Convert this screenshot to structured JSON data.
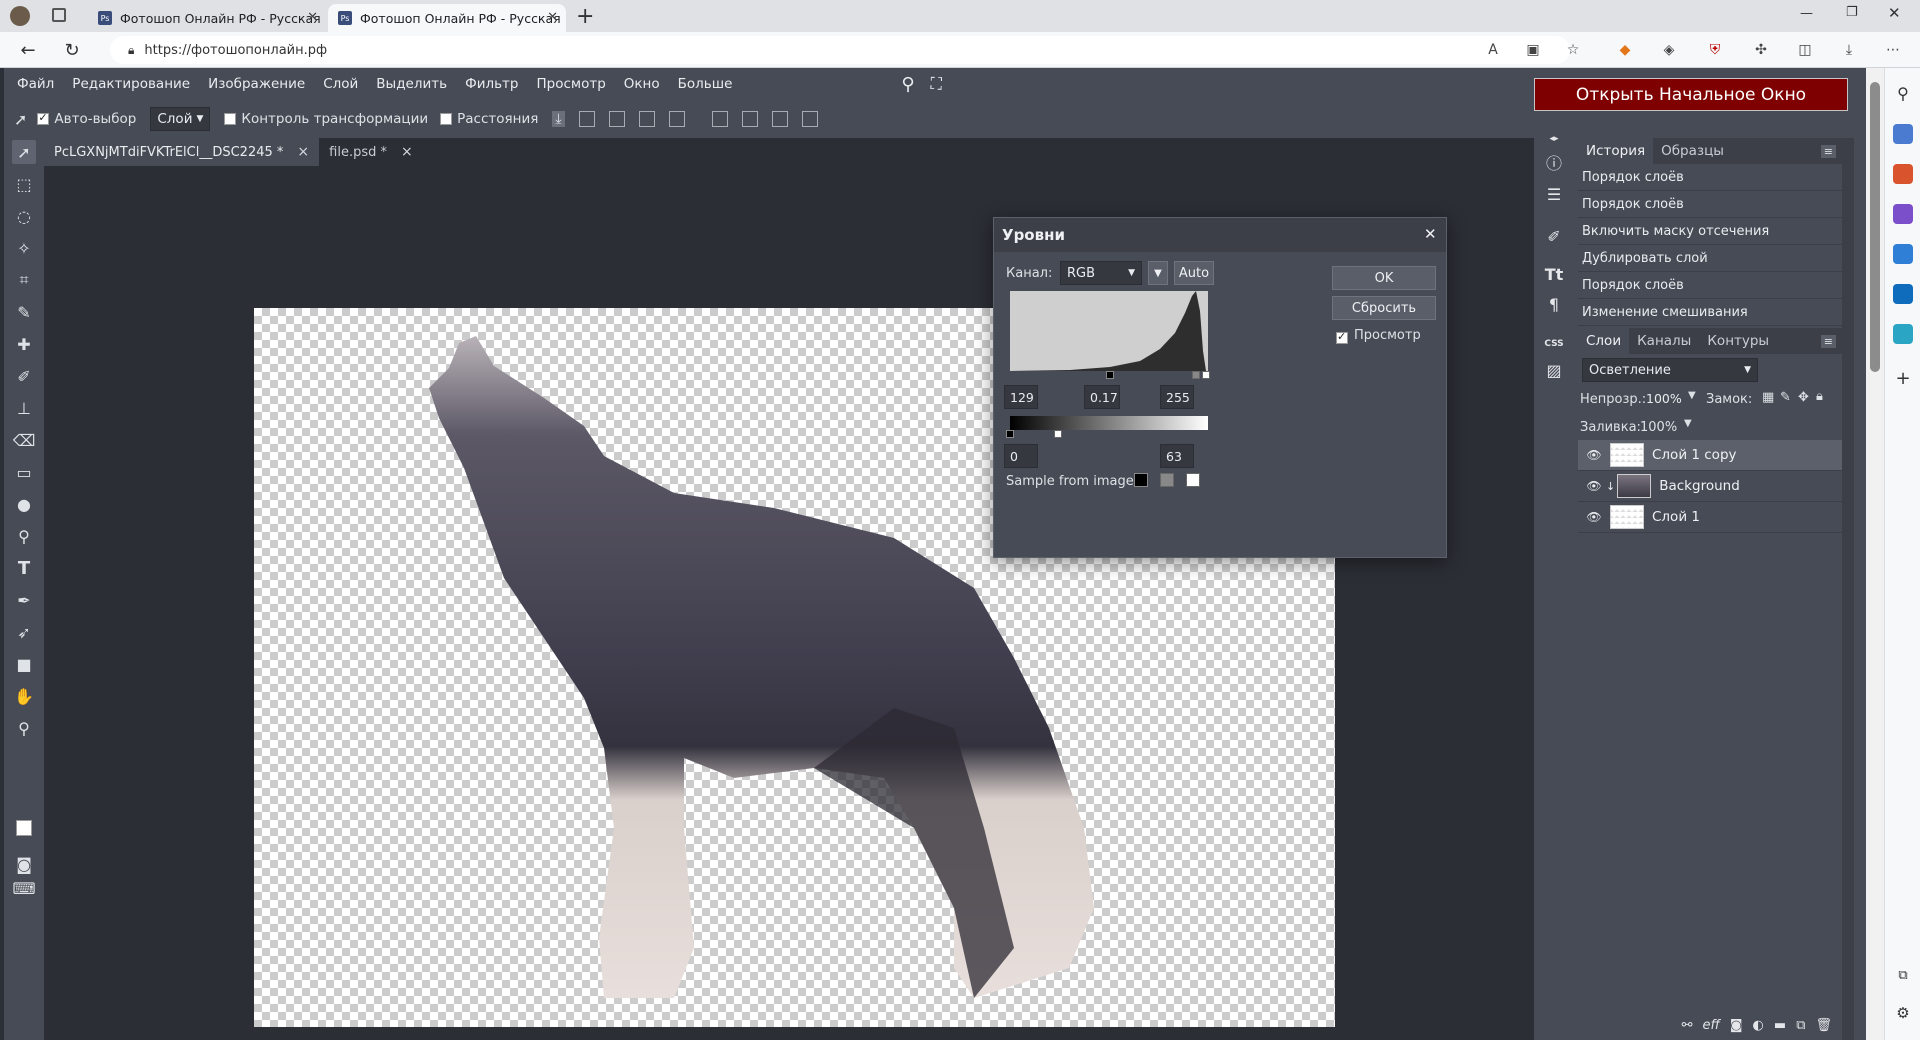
{
  "browser": {
    "tabs": [
      {
        "title": "Фотошоп Онлайн РФ - Русская",
        "active": false
      },
      {
        "title": "Фотошоп Онлайн РФ - Русская",
        "active": true
      }
    ],
    "url": "https://фотошопонлайн.рф",
    "new_tab": "+"
  },
  "app": {
    "menu": [
      "Файл",
      "Редактирование",
      "Изображение",
      "Слой",
      "Выделить",
      "Фильтр",
      "Просмотр",
      "Окно",
      "Больше"
    ],
    "open_start_label": "Открыть Начальное Окно",
    "options": {
      "autoselect_label": "Авто-выбор",
      "autoselect_value": "Слой",
      "transform_label": "Контроль трансформации",
      "distances_label": "Расстояния"
    },
    "doc_tabs": [
      {
        "name": "PcLGXNjMTdiFVKTrElCl__DSC2245 *",
        "close": "×",
        "active": true
      },
      {
        "name": "file.psd *",
        "close": "×",
        "active": false
      }
    ]
  },
  "levels": {
    "title": "Уровни",
    "channel_label": "Канал:",
    "channel_value": "RGB",
    "auto_label": "Auto",
    "ok_label": "OK",
    "reset_label": "Сбросить",
    "preview_label": "Просмотр",
    "input_black": "129",
    "input_gamma": "0.17",
    "input_white": "255",
    "output_black": "0",
    "output_white": "63",
    "sample_label": "Sample from image:"
  },
  "history": {
    "tabs": [
      "История",
      "Образцы"
    ],
    "items": [
      "Порядок слоёв",
      "Порядок слоёв",
      "Включить маску отсечения",
      "Дублировать слой",
      "Порядок слоёв",
      "Изменение смешивания"
    ]
  },
  "layers": {
    "tabs": [
      "Слои",
      "Каналы",
      "Контуры"
    ],
    "blend_mode": "Осветление",
    "opacity_label": "Непрозр.:",
    "opacity_value": "100%",
    "lock_label": "Замок:",
    "fill_label": "Заливка:",
    "fill_value": "100%",
    "items": [
      {
        "name": "Слой 1 copy",
        "selected": true
      },
      {
        "name": "Background",
        "selected": false
      },
      {
        "name": "Слой 1",
        "selected": false
      }
    ],
    "bottom_icons": [
      "link-icon",
      "effects-icon",
      "mask-icon",
      "adjustment-icon",
      "folder-icon",
      "new-layer-icon",
      "trash-icon"
    ]
  },
  "icons": {
    "back": "back-arrow-icon",
    "reload": "reload-icon",
    "search": "search-icon",
    "fullscreen": "fullscreen-icon"
  },
  "colors": {
    "open_start_bg": "#7e0000",
    "panel_bg": "#474b55",
    "doc_bg": "#2b2e35"
  }
}
